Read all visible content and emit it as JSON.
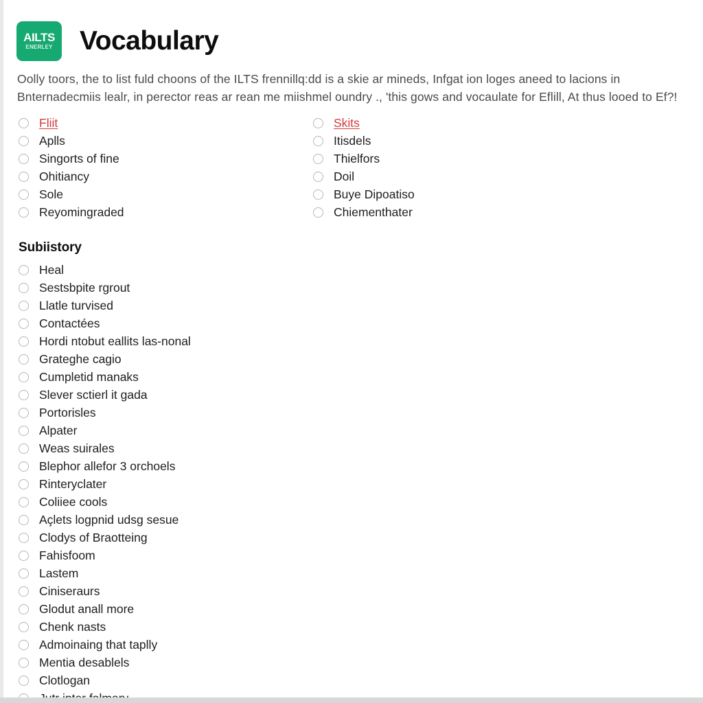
{
  "brand": {
    "logo_line1": "AILTS",
    "logo_line2": "ENERLEY",
    "logo_color": "#16a971"
  },
  "header": {
    "title": "Vocabulary"
  },
  "intro": {
    "text": "Oolly toors, the to list fuld choons of the ILTS frennillq:dd is a skie ar mineds, Infgat ion loges aneed to lacions in Bnternadecmiis lealr, in perector reas ar rean me miishmel oundry ., 'this gows and vocaulate for Eflill, At thus looed to Ef?!"
  },
  "colors": {
    "link": "#d23b3b",
    "text": "#1d1d1d",
    "muted": "#4a4a4a",
    "radio_border": "#b6b6b6"
  },
  "options_left": [
    {
      "label": "Fliit",
      "is_link": true
    },
    {
      "label": "Aplls",
      "is_link": false
    },
    {
      "label": "Singorts of fine",
      "is_link": false
    },
    {
      "label": "Ohitiancy",
      "is_link": false
    },
    {
      "label": "Sole",
      "is_link": false
    },
    {
      "label": "Reyomingraded",
      "is_link": false
    }
  ],
  "options_right": [
    {
      "label": "Skits",
      "is_link": true
    },
    {
      "label": "Itisdels",
      "is_link": false
    },
    {
      "label": "Thielfors",
      "is_link": false
    },
    {
      "label": "Doil",
      "is_link": false
    },
    {
      "label": "Buye Dipoatiso",
      "is_link": false
    },
    {
      "label": "Chiementhater",
      "is_link": false
    }
  ],
  "section": {
    "title": "Subiistory",
    "options": [
      {
        "label": "Heal"
      },
      {
        "label": "Sestsbpite rgrout"
      },
      {
        "label": "Llatle turvised"
      },
      {
        "label": "Contactées"
      },
      {
        "label": "Hordi ntobut eallits las-nonal"
      },
      {
        "label": "Grateghe cagio"
      },
      {
        "label": "Cumpletid manaks"
      },
      {
        "label": "Slever sctierl it gada"
      },
      {
        "label": "Portorisles"
      },
      {
        "label": "Alpater"
      },
      {
        "label": "Weas suirales"
      },
      {
        "label": "Blephor allefor 3 orchoels"
      },
      {
        "label": "Rinteryclater"
      },
      {
        "label": "Coliiee cools"
      },
      {
        "label": "Açlets logpnid udsg sesue"
      },
      {
        "label": "Clodys of Braotteing"
      },
      {
        "label": "Fahisfoom"
      },
      {
        "label": "Lastem"
      },
      {
        "label": "Ciniseraurs"
      },
      {
        "label": "Glodut anall more"
      },
      {
        "label": "Chenk nasts"
      },
      {
        "label": "Admoinaing that taplly"
      },
      {
        "label": "Mentia desablels"
      },
      {
        "label": "Clotlogan"
      },
      {
        "label": "Jutr inter falmary"
      }
    ]
  }
}
